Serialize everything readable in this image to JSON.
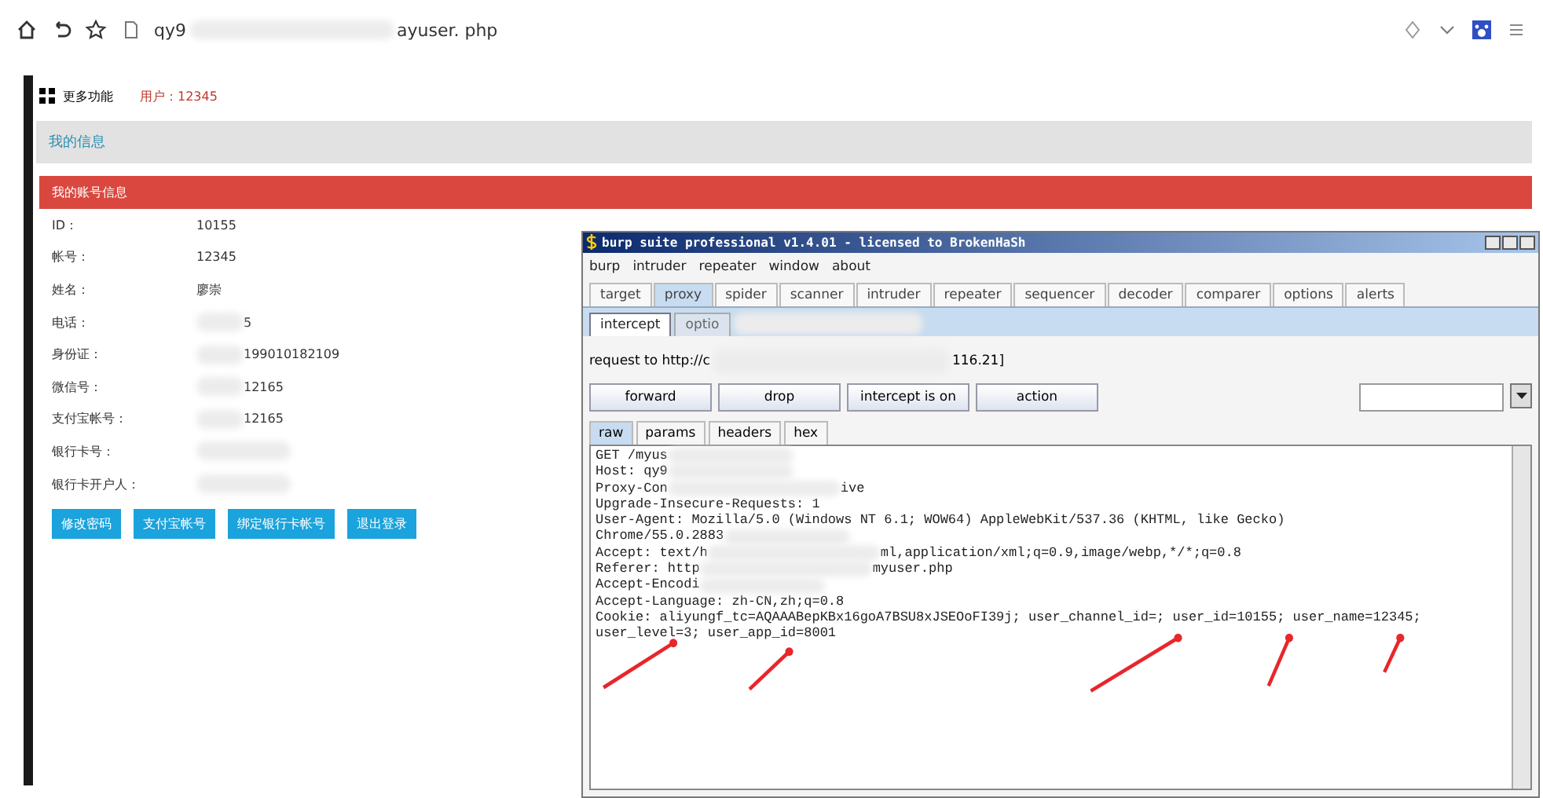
{
  "browser": {
    "url_start": "qy9",
    "url_end": "ayuser. php"
  },
  "page": {
    "menu_label": "更多功能",
    "user_label": "用户：12345",
    "section_title": "我的信息",
    "panel_title": "我的账号信息",
    "fields": [
      {
        "label": "ID：",
        "value": "10155",
        "blurred": false
      },
      {
        "label": "帐号：",
        "value": "12345",
        "blurred": false
      },
      {
        "label": "姓名：",
        "value": "廖崇",
        "blurred": false
      },
      {
        "label": "电话：",
        "value": "5",
        "blurred": true
      },
      {
        "label": "身份证：",
        "value": "199010182109",
        "blurred": true
      },
      {
        "label": "微信号：",
        "value": "12165",
        "blurred": true
      },
      {
        "label": "支付宝帐号：",
        "value": "12165",
        "blurred": true
      },
      {
        "label": "银行卡号：",
        "blurred": true
      },
      {
        "label": "银行卡开户人：",
        "blurred": true
      }
    ],
    "buttons": [
      "修改密码",
      "支付宝帐号",
      "绑定银行卡帐号",
      "退出登录"
    ]
  },
  "burp": {
    "title": "burp suite professional v1.4.01 - licensed to BrokenHaSh",
    "menu": [
      "burp",
      "intruder",
      "repeater",
      "window",
      "about"
    ],
    "tabs": [
      {
        "label": "target",
        "selected": false
      },
      {
        "label": "proxy",
        "selected": true
      },
      {
        "label": "spider",
        "selected": false
      },
      {
        "label": "scanner",
        "selected": false
      },
      {
        "label": "intruder",
        "selected": false
      },
      {
        "label": "repeater",
        "selected": false
      },
      {
        "label": "sequencer",
        "selected": false
      },
      {
        "label": "decoder",
        "selected": false
      },
      {
        "label": "comparer",
        "selected": false
      },
      {
        "label": "options",
        "selected": false
      },
      {
        "label": "alerts",
        "selected": false
      }
    ],
    "subtabs": [
      {
        "label": "intercept",
        "selected": true
      },
      {
        "label": "optio",
        "selected": false
      }
    ],
    "request_start": "request to http://c",
    "request_end": "116.21]",
    "actions": [
      "forward",
      "drop",
      "intercept is on",
      "action"
    ],
    "view_tabs": [
      {
        "label": "raw",
        "selected": true
      },
      {
        "label": "params",
        "selected": false
      },
      {
        "label": "headers",
        "selected": false
      },
      {
        "label": "hex",
        "selected": false
      }
    ],
    "lines": [
      {
        "text": "GET /myus",
        "blurred": true
      },
      {
        "text": "Host: qy9",
        "blurred": true
      },
      {
        "text": "Proxy-Con",
        "blurred": true,
        "tail": "ive"
      },
      {
        "text": "Upgrade-Insecure-Requests: 1",
        "blurred": false
      },
      {
        "text": "User-Agent: Mozilla/5.0 (Windows NT 6.1; WOW64) AppleWebKit/537.36 (KHTML, like Gecko)",
        "blurred": false
      },
      {
        "text": "Chrome/55.0.2883",
        "blurred": true
      },
      {
        "text": "Accept: text/h",
        "blurred": true,
        "tail": "ml,application/xml;q=0.9,image/webp,*/*;q=0.8"
      },
      {
        "text": "Referer: http",
        "blurred": true,
        "tail": "myuser.php"
      },
      {
        "text": "Accept-Encodi",
        "blurred": true
      },
      {
        "text": "Accept-Language: zh-CN,zh;q=0.8",
        "blurred": false
      },
      {
        "text": "Cookie: aliyungf_tc=AQAAABepKBx16goA7BSU8xJSEOoFI39j; user_channel_id=; user_id=10155; user_name=12345;",
        "blurred": false
      },
      {
        "text": "user_level=3; user_app_id=8001",
        "blurred": false
      }
    ]
  }
}
